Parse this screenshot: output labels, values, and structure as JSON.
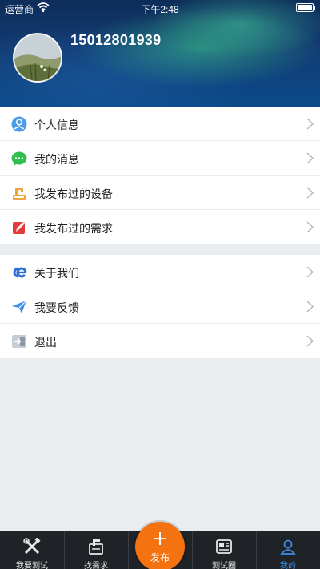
{
  "status_bar": {
    "carrier": "运营商",
    "time": "下午2:48"
  },
  "profile": {
    "username": "15012801939"
  },
  "menu": {
    "group1": [
      {
        "label": "个人信息",
        "icon": "person-icon",
        "color": "#4a9be8"
      },
      {
        "label": "我的消息",
        "icon": "chat-bubble-icon",
        "color": "#2fbf4d"
      },
      {
        "label": "我发布过的设备",
        "icon": "device-icon",
        "color": "#f2a53a"
      },
      {
        "label": "我发布过的需求",
        "icon": "edit-note-icon",
        "color": "#e23b3b"
      }
    ],
    "group2": [
      {
        "label": "关于我们",
        "icon": "link-logo-icon",
        "color": "#2b6fd6"
      },
      {
        "label": "我要反馈",
        "icon": "paper-plane-icon",
        "color": "#3b8de8"
      },
      {
        "label": "退出",
        "icon": "logout-icon",
        "color": "#9aa3ad"
      }
    ]
  },
  "tabbar": {
    "tabs": [
      {
        "label": "我要测试",
        "icon": "tools-icon",
        "active": false
      },
      {
        "label": "找需求",
        "icon": "document-icon",
        "active": false
      },
      {
        "label": "测试圈",
        "icon": "news-icon",
        "active": false
      },
      {
        "label": "我的",
        "icon": "user-icon",
        "active": true
      }
    ],
    "publish_label": "发布",
    "publish_color": "#f4720f",
    "active_color": "#3b8de8"
  }
}
